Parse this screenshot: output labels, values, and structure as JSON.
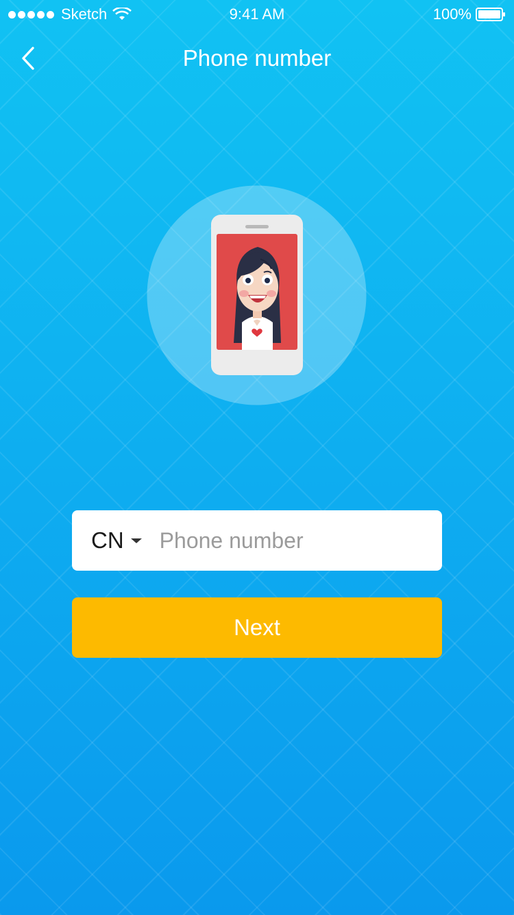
{
  "status_bar": {
    "carrier": "Sketch",
    "time": "9:41 AM",
    "battery": "100%",
    "icons": [
      "signal-dots-icon",
      "wifi-icon",
      "battery-icon"
    ]
  },
  "nav": {
    "back_icon": "chevron-left-icon",
    "title": "Phone number"
  },
  "illustration": {
    "description_icon": "phone-avatar-illustration"
  },
  "form": {
    "country_code": "CN",
    "country_dropdown_icon": "caret-down-icon",
    "phone_placeholder": "Phone number",
    "phone_value": ""
  },
  "actions": {
    "next_label": "Next"
  },
  "colors": {
    "background_top": "#11c2f3",
    "background_bottom": "#0a99ed",
    "button": "#fdba00",
    "screen_red": "#e04a4a"
  }
}
